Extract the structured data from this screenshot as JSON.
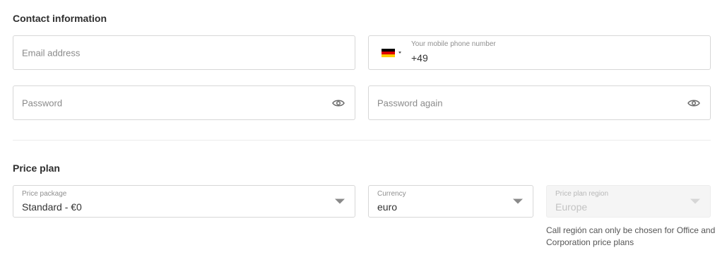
{
  "contact": {
    "title": "Contact information",
    "email": {
      "placeholder": "Email address"
    },
    "phone": {
      "label": "Your mobile phone number",
      "value": "+49",
      "country_flag": "germany-flag"
    },
    "password": {
      "placeholder": "Password",
      "icon": "eye-icon"
    },
    "password_again": {
      "placeholder": "Password again",
      "icon": "eye-icon"
    }
  },
  "price_plan": {
    "title": "Price plan",
    "package": {
      "label": "Price package",
      "value": "Standard - €0"
    },
    "currency": {
      "label": "Currency",
      "value": "euro"
    },
    "region": {
      "label": "Price plan region",
      "value": "Europe",
      "disabled": true,
      "hint": "Call región can only be chosen for Office and Corporation price plans"
    }
  },
  "colors": {
    "border": "#d7d7d7",
    "text": "#333333",
    "placeholder": "#8a8a8a",
    "disabled_bg": "#f5f5f5"
  }
}
